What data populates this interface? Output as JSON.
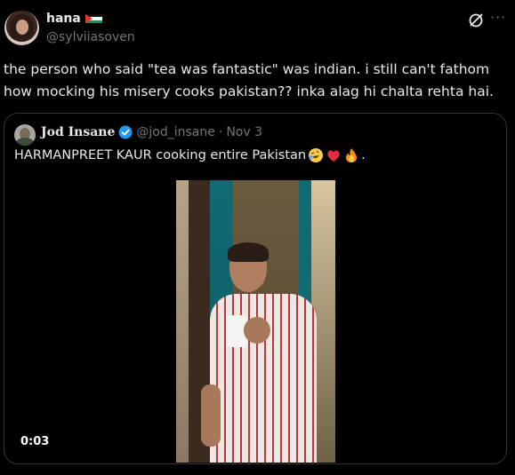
{
  "author": {
    "display_name": "hana",
    "handle": "@sylviiasoven",
    "flag_icon": "palestine-flag-icon"
  },
  "tweet_text": "the person who said \"tea was fantastic\" was indian. i still can't fathom how mocking his misery cooks pakistan?? inka alag hi chalta rehta hai.",
  "header_icons": [
    "grok-icon",
    "more-icon"
  ],
  "quoted": {
    "display_name": "Jod Insane",
    "handle": "@jod_insane",
    "separator": "·",
    "date": "Nov 3",
    "text": "HARMANPREET KAUR cooking entire Pakistan",
    "trailing": ".",
    "emojis": [
      "rofl-emoji",
      "red-heart-emoji",
      "fire-emoji"
    ]
  },
  "video": {
    "timestamp": "0:03"
  },
  "colors": {
    "background": "#000000",
    "text": "#e7e9ea",
    "secondary": "#71767b",
    "border": "#2f3336",
    "verified": "#1d9bf0"
  }
}
